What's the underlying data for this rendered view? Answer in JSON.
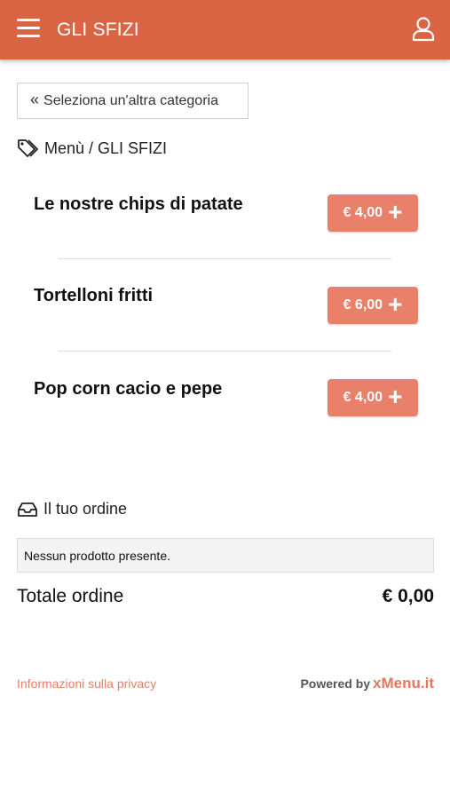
{
  "header": {
    "title": "GLI SFIZI",
    "background_color": "#d96544"
  },
  "back_button": {
    "chevron": "«",
    "label": "Seleziona un'altra categoria"
  },
  "breadcrumb": {
    "icon": "tags-icon",
    "text": "Menù / GLI SFIZI"
  },
  "items": [
    {
      "name": "Le nostre chips di patate",
      "price": "€ 4,00",
      "add": "+"
    },
    {
      "name": "Tortelloni fritti",
      "price": "€ 6,00",
      "add": "+"
    },
    {
      "name": "Pop corn cacio e pepe",
      "price": "€ 4,00",
      "add": "+"
    }
  ],
  "order": {
    "icon": "inbox-icon",
    "title": "Il tuo ordine",
    "empty_message": "Nessun prodotto presente.",
    "total_label": "Totale ordine",
    "total_value": "€ 0,00"
  },
  "footer": {
    "privacy_link": "Informazioni sulla privacy",
    "powered_by": "Powered by",
    "brand": "xMenu.it"
  },
  "colors": {
    "accent": "#d96544",
    "price_button": "#e8806a"
  }
}
